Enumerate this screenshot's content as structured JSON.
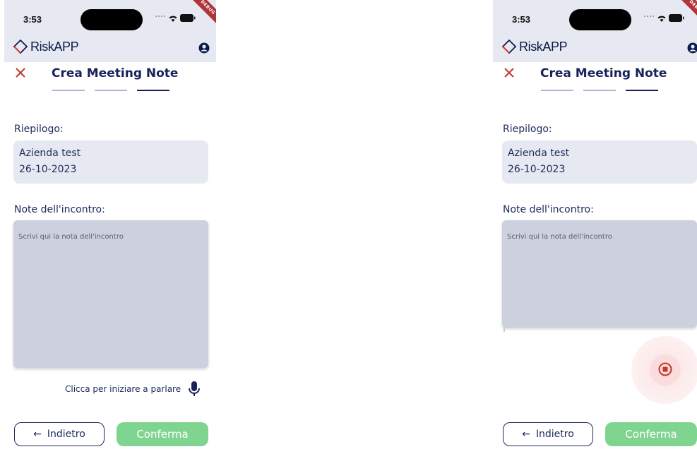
{
  "status_bar": {
    "time": "3:53",
    "debug_label": "DEBUG"
  },
  "app": {
    "brand": "RiskAPP"
  },
  "page": {
    "title": "Crea Meeting Note",
    "steps_total": 3,
    "current_step": 3
  },
  "summary": {
    "label": "Riepilogo:",
    "company": "Azienda test",
    "date": "26-10-2023"
  },
  "notes": {
    "label": "Note dell'incontro:",
    "placeholder": "Scrivi qui la nota dell'incontro",
    "value": ""
  },
  "voice": {
    "idle_hint": "Clicca per iniziare a parlare",
    "recording_state": "recording"
  },
  "buttons": {
    "back": "Indietro",
    "confirm": "Conferma"
  },
  "colors": {
    "primary": "#17215a",
    "accent_red": "#c0392b",
    "confirm_green": "#7fd58f",
    "surface": "#e6e9f1"
  },
  "icons": {
    "close": "close-icon",
    "profile": "profile-icon",
    "mic": "mic-icon",
    "stop": "stop-icon",
    "back_arrow": "←"
  }
}
